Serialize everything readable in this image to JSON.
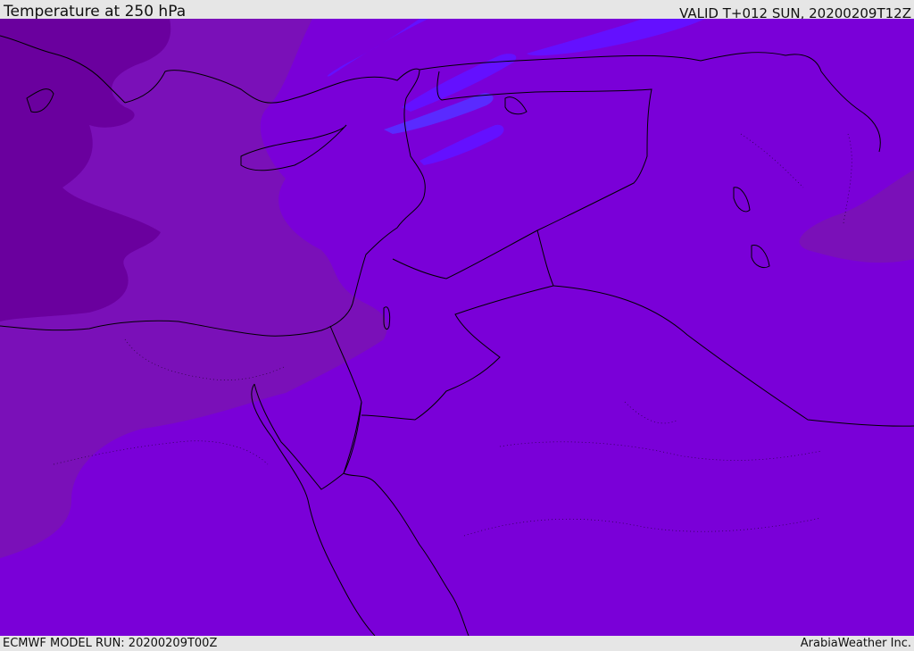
{
  "header": {
    "title": "Temperature at 250 hPa",
    "valid_time": "VALID T+012 SUN, 20200209T12Z"
  },
  "footer": {
    "model_run": "ECMWF MODEL RUN: 20200209T00Z",
    "credit": "ArabiaWeather Inc."
  },
  "colors": {
    "field_base": "#7a00d8",
    "field_cooler": "#7a10b8",
    "field_coldest": "#6a009e",
    "field_warmer": "#6410ff",
    "field_warmest": "#5a2aff",
    "coastline": "#000000",
    "bars": "#e6e6e6"
  }
}
